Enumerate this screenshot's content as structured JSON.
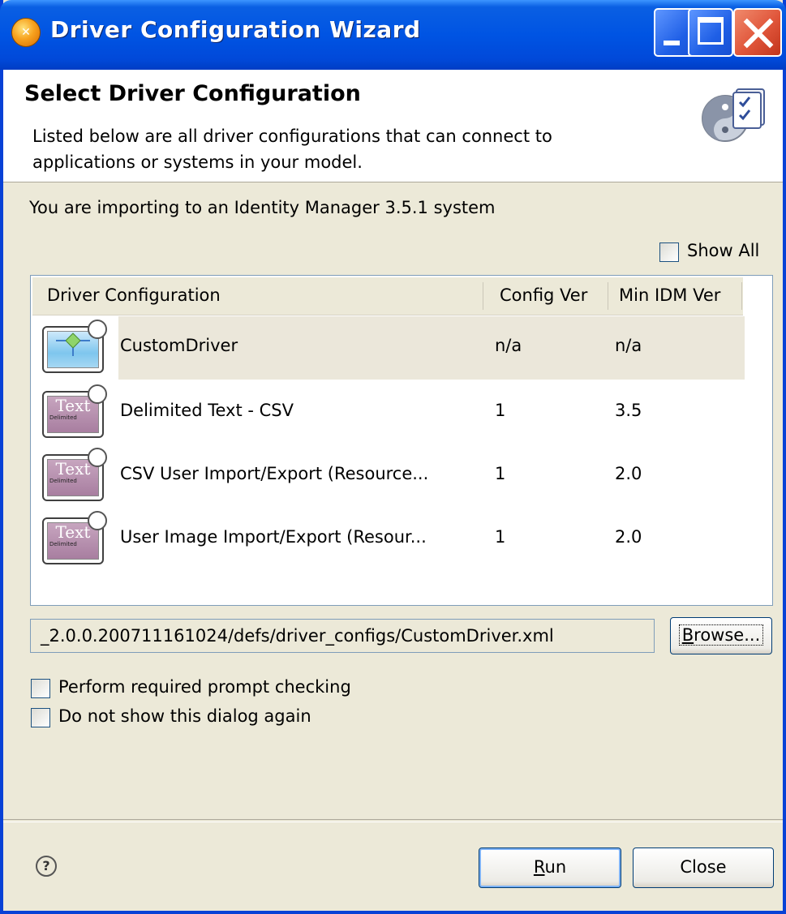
{
  "window": {
    "title": "Driver Configuration Wizard"
  },
  "header": {
    "title": "Select Driver Configuration",
    "description": "Listed below are all driver configurations that can connect to applications or systems in your model."
  },
  "import_note": "You are importing to an Identity Manager 3.5.1 system",
  "show_all": {
    "label": "Show All",
    "checked": false
  },
  "table": {
    "columns": [
      "Driver Configuration",
      "Config Ver",
      "Min IDM Ver"
    ],
    "rows": [
      {
        "name": "CustomDriver",
        "config_ver": "n/a",
        "min_idm_ver": "n/a",
        "icon": "custom-driver-icon",
        "selected": true
      },
      {
        "name": "Delimited Text - CSV",
        "config_ver": "1",
        "min_idm_ver": "3.5",
        "icon": "text-driver-icon",
        "selected": false
      },
      {
        "name": "CSV User Import/Export (Resource...",
        "config_ver": "1",
        "min_idm_ver": "2.0",
        "icon": "text-driver-icon",
        "selected": false
      },
      {
        "name": "User Image Import/Export (Resour...",
        "config_ver": "1",
        "min_idm_ver": "2.0",
        "icon": "text-driver-icon",
        "selected": false
      }
    ],
    "icon_text": "Text",
    "icon_subtext": "Delimited"
  },
  "path": {
    "value": "_2.0.0.200711161024/defs/driver_configs/CustomDriver.xml"
  },
  "browse_button": {
    "label_underlined": "B",
    "label_rest": "rowse..."
  },
  "options": {
    "prompt_check": {
      "label": "Perform required prompt checking",
      "checked": false
    },
    "no_show": {
      "label": "Do not show this dialog again",
      "checked": false
    }
  },
  "footer": {
    "help_icon": "?",
    "run_underlined": "R",
    "run_rest": "un",
    "close_label": "Close"
  },
  "colors": {
    "titlebar": "#0054e3",
    "dialog_bg": "#ece9d8",
    "selected_row": "#ebe7da",
    "close_button": "#e0553a"
  }
}
